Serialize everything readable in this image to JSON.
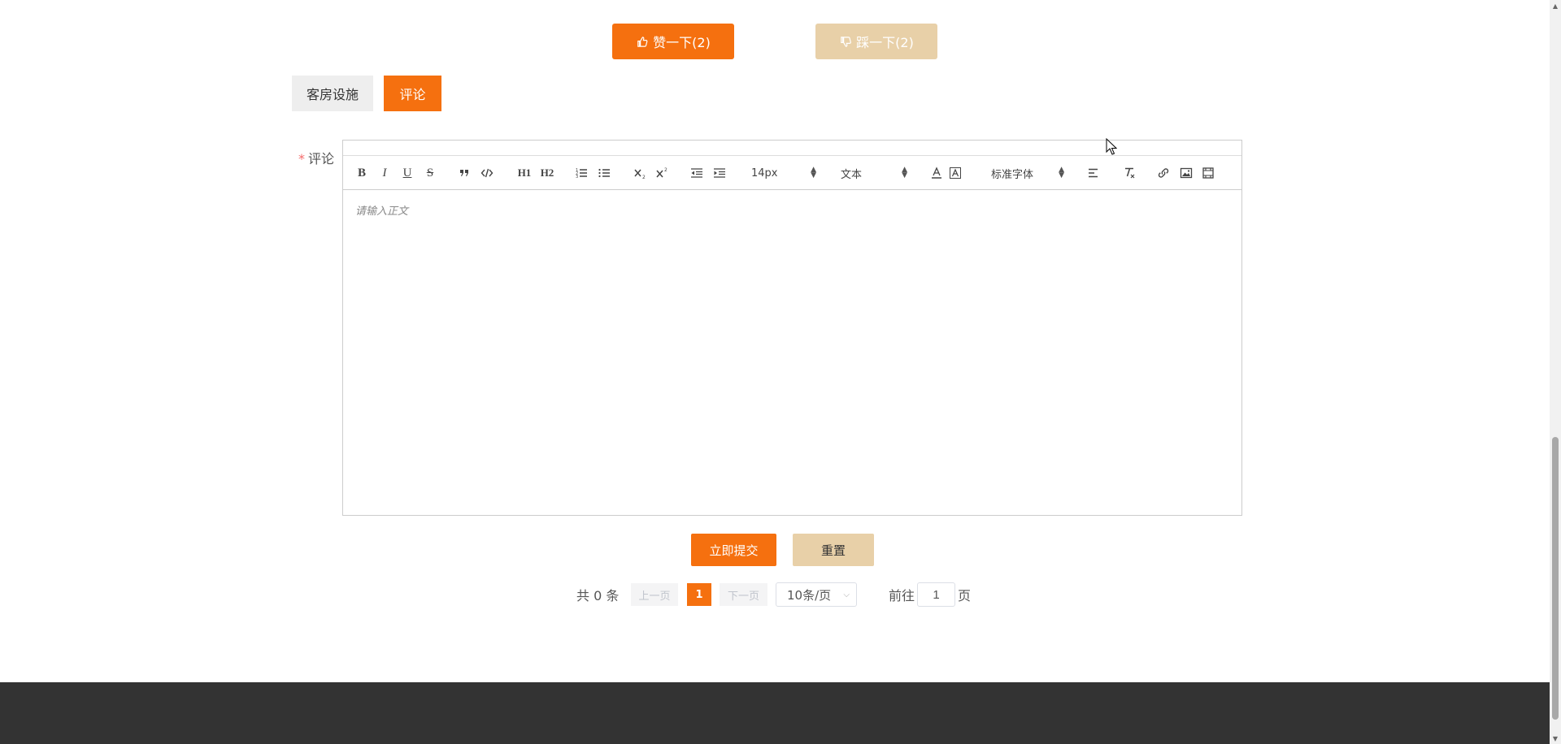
{
  "vote": {
    "like_label": "赞一下(2)",
    "dislike_label": "踩一下(2)"
  },
  "tabs": [
    {
      "label": "客房设施",
      "active": false
    },
    {
      "label": "评论",
      "active": true
    }
  ],
  "form": {
    "required_mark": "*",
    "comment_label": "评论"
  },
  "editor": {
    "toolbar": {
      "h1": "H1",
      "h2": "H2",
      "font_size": "14px",
      "header_type": "文本",
      "font_family": "标准字体"
    },
    "placeholder": "请输入正文"
  },
  "actions": {
    "submit_label": "立即提交",
    "reset_label": "重置"
  },
  "pagination": {
    "total_text": "共 0 条",
    "prev_label": "上一页",
    "current_page": "1",
    "next_label": "下一页",
    "page_size": "10条/页",
    "jump_prefix": "前往",
    "jump_value": "1",
    "jump_suffix": "页"
  },
  "colors": {
    "accent": "#f5700f",
    "accent_light": "#e8d0a8",
    "footer": "#333333"
  }
}
